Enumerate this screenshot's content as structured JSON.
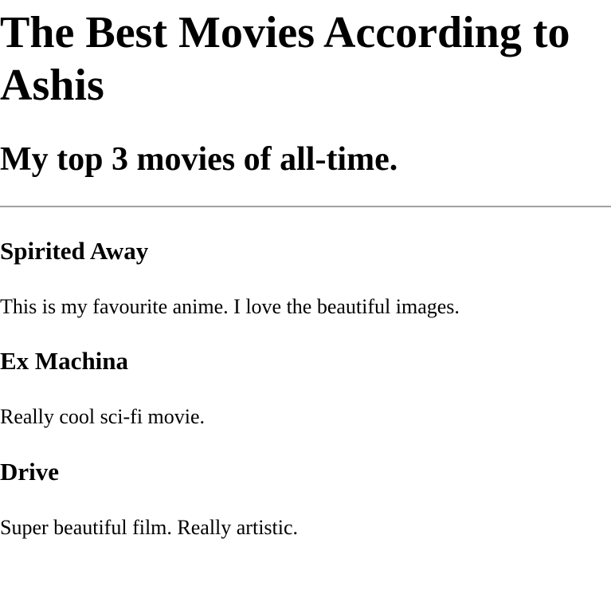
{
  "page": {
    "title": "The Best Movies According to Ashis",
    "subtitle": "My top 3 movies of all-time."
  },
  "movies": [
    {
      "title": "Spirited Away",
      "description": "This is my favourite anime. I love the beautiful images."
    },
    {
      "title": "Ex Machina",
      "description": "Really cool sci-fi movie."
    },
    {
      "title": "Drive",
      "description": "Super beautiful film. Really artistic."
    }
  ]
}
